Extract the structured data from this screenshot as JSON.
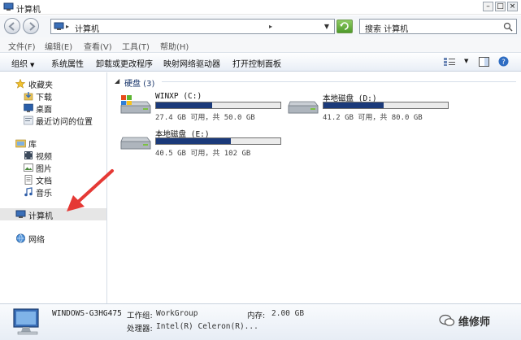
{
  "window": {
    "title": "计算机"
  },
  "address": {
    "location": "计算机",
    "search_placeholder": "搜索 计算机"
  },
  "menu": [
    "文件(F)",
    "编辑(E)",
    "查看(V)",
    "工具(T)",
    "帮助(H)"
  ],
  "toolbar": {
    "organize": "组织",
    "system_properties": "系统属性",
    "uninstall": "卸载或更改程序",
    "map_drive": "映射网络驱动器",
    "control_panel": "打开控制面板"
  },
  "sidebar": {
    "favorites": "收藏夹",
    "downloads": "下载",
    "desktop": "桌面",
    "recent": "最近访问的位置",
    "libraries": "库",
    "videos": "视频",
    "pictures": "图片",
    "documents": "文档",
    "music": "音乐",
    "computer": "计算机",
    "network": "网络"
  },
  "content": {
    "group_label": "硬盘 (3)",
    "drives": [
      {
        "name": "WINXP (C:)",
        "free_text": "27.4 GB 可用，共 50.0 GB",
        "used_fraction": 0.452
      },
      {
        "name": "本地磁盘 (D:)",
        "free_text": "41.2 GB 可用，共 80.0 GB",
        "used_fraction": 0.485
      },
      {
        "name": "本地磁盘 (E:)",
        "free_text": "40.5 GB 可用，共 102 GB",
        "used_fraction": 0.603
      }
    ]
  },
  "details": {
    "computer_name": "WINDOWS-G3HG475",
    "workgroup_label": "工作组:",
    "workgroup_value": "WorkGroup",
    "memory_label": "内存:",
    "memory_value": "2.00 GB",
    "processor_label": "处理器:",
    "processor_value": "Intel(R) Celeron(R)..."
  },
  "watermark": {
    "text": "维修师"
  },
  "colors": {
    "drive_fill": "#1b3a7a",
    "arrow": "#e53935",
    "selection": "#e6e6e6"
  }
}
